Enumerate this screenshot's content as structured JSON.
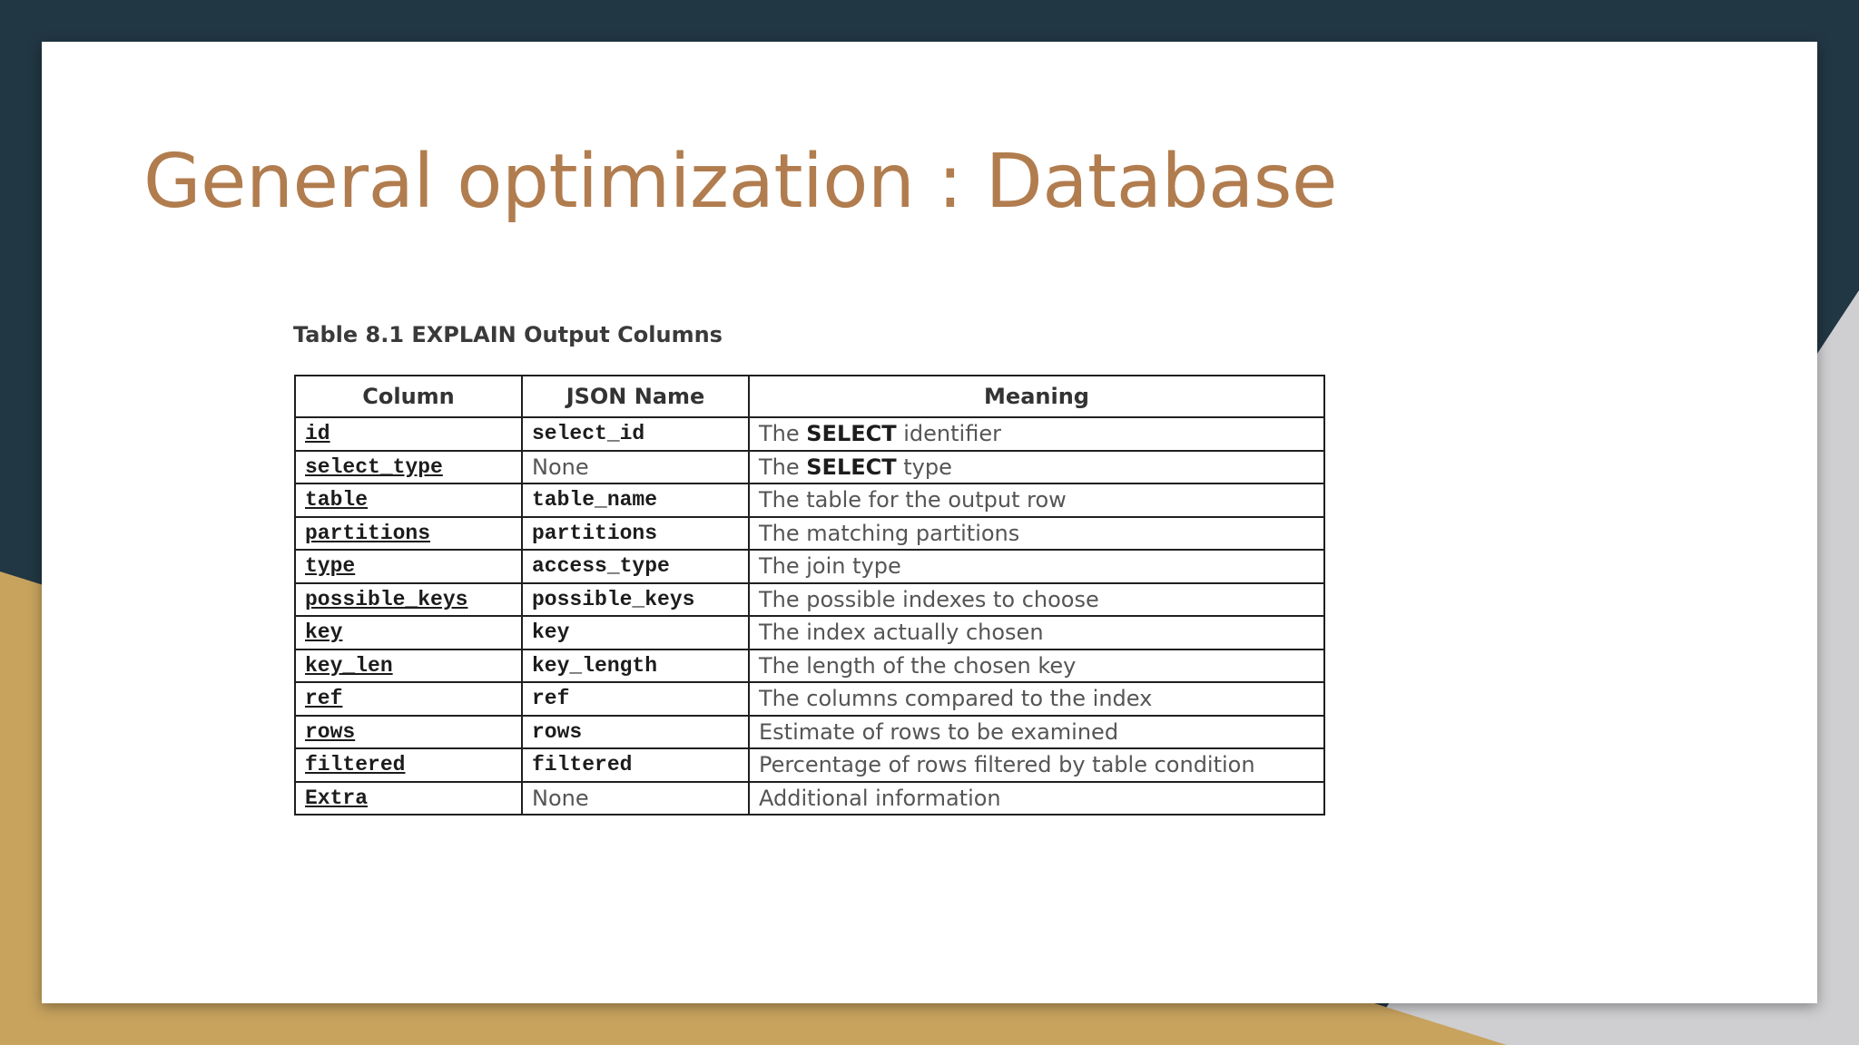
{
  "colors": {
    "title": "#B17C4E",
    "background_dark": "#213743",
    "background_gold": "#C8A35E",
    "background_gray": "#CFCFD2",
    "slide": "#FFFFFF"
  },
  "slide": {
    "title": "General optimization : Database",
    "table_caption": "Table 8.1 EXPLAIN Output Columns",
    "table": {
      "headers": [
        "Column",
        "JSON Name",
        "Meaning"
      ],
      "rows": [
        {
          "column": "id",
          "json_name": "select_id",
          "json_mono": true,
          "meaning_prefix": "The ",
          "meaning_keyword": "SELECT",
          "meaning_suffix": " identifier"
        },
        {
          "column": "select_type",
          "json_name": "None",
          "json_mono": false,
          "meaning_prefix": "The ",
          "meaning_keyword": "SELECT",
          "meaning_suffix": " type"
        },
        {
          "column": "table",
          "json_name": "table_name",
          "json_mono": true,
          "meaning_prefix": "The table for the output row",
          "meaning_keyword": "",
          "meaning_suffix": ""
        },
        {
          "column": "partitions",
          "json_name": "partitions",
          "json_mono": true,
          "meaning_prefix": "The matching partitions",
          "meaning_keyword": "",
          "meaning_suffix": ""
        },
        {
          "column": "type",
          "json_name": "access_type",
          "json_mono": true,
          "meaning_prefix": "The join type",
          "meaning_keyword": "",
          "meaning_suffix": ""
        },
        {
          "column": "possible_keys",
          "json_name": "possible_keys",
          "json_mono": true,
          "meaning_prefix": "The possible indexes to choose",
          "meaning_keyword": "",
          "meaning_suffix": ""
        },
        {
          "column": "key",
          "json_name": "key",
          "json_mono": true,
          "meaning_prefix": "The index actually chosen",
          "meaning_keyword": "",
          "meaning_suffix": ""
        },
        {
          "column": "key_len",
          "json_name": "key_length",
          "json_mono": true,
          "meaning_prefix": "The length of the chosen key",
          "meaning_keyword": "",
          "meaning_suffix": ""
        },
        {
          "column": "ref",
          "json_name": "ref",
          "json_mono": true,
          "meaning_prefix": "The columns compared to the index",
          "meaning_keyword": "",
          "meaning_suffix": ""
        },
        {
          "column": "rows",
          "json_name": "rows",
          "json_mono": true,
          "meaning_prefix": "Estimate of rows to be examined",
          "meaning_keyword": "",
          "meaning_suffix": ""
        },
        {
          "column": "filtered",
          "json_name": "filtered",
          "json_mono": true,
          "meaning_prefix": "Percentage of rows filtered by table condition",
          "meaning_keyword": "",
          "meaning_suffix": ""
        },
        {
          "column": "Extra",
          "json_name": "None",
          "json_mono": false,
          "meaning_prefix": "Additional information",
          "meaning_keyword": "",
          "meaning_suffix": ""
        }
      ]
    }
  }
}
